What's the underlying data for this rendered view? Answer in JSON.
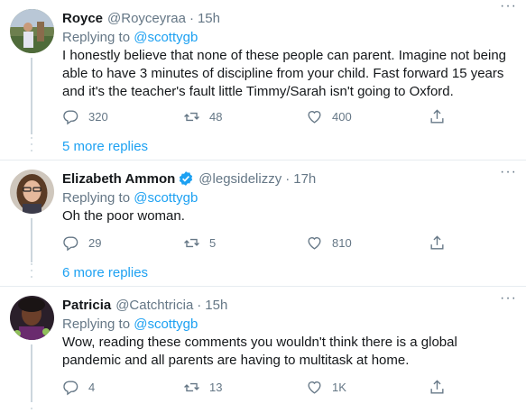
{
  "tweets": [
    {
      "name": "Royce",
      "handle": "@Royceyraa",
      "sep": "·",
      "time": "15h",
      "replying_prefix": "Replying to ",
      "replying_to": "@scottygb",
      "text": "I honestly believe that none of these people can parent. Imagine not being able to have 3 minutes of discipline from your child. Fast forward 15 years and it's the teacher's fault little Timmy/Sarah isn't going to Oxford.",
      "replies": "320",
      "retweets": "48",
      "likes": "400",
      "more_replies": "5 more replies",
      "verified": false
    },
    {
      "name": "Elizabeth Ammon",
      "handle": "@legsidelizzy",
      "sep": "·",
      "time": "17h",
      "replying_prefix": "Replying to ",
      "replying_to": "@scottygb",
      "text": "Oh the poor woman.",
      "replies": "29",
      "retweets": "5",
      "likes": "810",
      "more_replies": "6 more replies",
      "verified": true
    },
    {
      "name": "Patricia",
      "handle": "@Catchtricia",
      "sep": "·",
      "time": "15h",
      "replying_prefix": "Replying to ",
      "replying_to": "@scottygb",
      "text": "Wow, reading these comments you wouldn't think there is a global pandemic and all parents are having to multitask at home.",
      "replies": "4",
      "retweets": "13",
      "likes": "1K",
      "verified": false
    }
  ],
  "icons": {
    "reply": "reply-icon",
    "retweet": "retweet-icon",
    "like": "heart-icon",
    "share": "share-icon",
    "more": "more-icon",
    "verified": "verified-badge-icon"
  },
  "colors": {
    "accent": "#1da1f2",
    "secondary_text": "#657786",
    "divider": "#e6ecf0"
  }
}
